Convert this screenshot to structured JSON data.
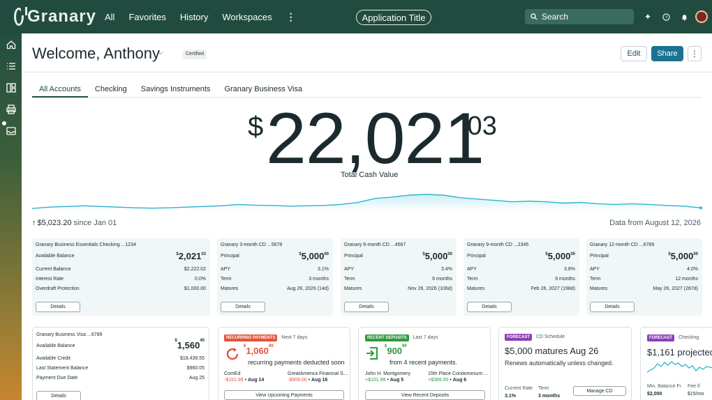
{
  "brand": {
    "name": "Granary"
  },
  "nav": {
    "items": [
      "All",
      "Favorites",
      "History",
      "Workspaces"
    ],
    "more": "⋮"
  },
  "app_title": "Application Title",
  "search": {
    "placeholder": "Search"
  },
  "header": {
    "welcome": "Welcome, Anthony",
    "badge": "Certified",
    "edit": "Edit",
    "share": "Share",
    "more": "⋮"
  },
  "tabs": [
    "All Accounts",
    "Checking",
    "Savings Instruments",
    "Granary Business Visa"
  ],
  "summary": {
    "currency": "$",
    "integer": "22,021",
    "decimal": ".03",
    "label": "Total Cash Value",
    "since_amount": "$5,023.20",
    "since_text": "since Jan 01",
    "data_from": "Data from August 12, 2026"
  },
  "sparkline": [
    0.92,
    0.88,
    0.86,
    0.84,
    0.86,
    0.88,
    0.9,
    0.91,
    0.9,
    0.88,
    0.86,
    0.84,
    0.8,
    0.82,
    0.83,
    0.85,
    0.84,
    0.83,
    0.8,
    0.74,
    0.62,
    0.58,
    0.52,
    0.5,
    0.52,
    0.6,
    0.64,
    0.68,
    0.72,
    0.7,
    0.72,
    0.76,
    0.74,
    0.78,
    0.8,
    0.78,
    0.8,
    0.83,
    0.85,
    0.9
  ],
  "accounts": [
    {
      "title": "Granary Business Essentials Checking ...1234",
      "main_label": "Available Balance",
      "amount": "2,021",
      "cents": "03",
      "rows": [
        [
          "Current Balance",
          "$2,222.02"
        ],
        [
          "Interest Rate",
          "0.0%"
        ],
        [
          "Overdraft Protection",
          "$1,000.00"
        ]
      ],
      "button": "Details"
    },
    {
      "title": "Granary 3-month CD ...5678",
      "main_label": "Principal",
      "amount": "5,000",
      "cents": "00",
      "rows": [
        [
          "APY",
          "3.1%"
        ],
        [
          "Term",
          "3 months"
        ],
        [
          "Matures",
          "Aug 26, 2026 (14d)"
        ]
      ],
      "button": "Details"
    },
    {
      "title": "Granary 6-month CD ...4567",
      "main_label": "Principal",
      "amount": "5,000",
      "cents": "00",
      "rows": [
        [
          "APY",
          "3.4%"
        ],
        [
          "Term",
          "6 months"
        ],
        [
          "Matures",
          "Nov 26, 2026 (106d)"
        ]
      ],
      "button": "Details"
    },
    {
      "title": "Granary 9-month CD ...2345",
      "main_label": "Principal",
      "amount": "5,000",
      "cents": "00",
      "rows": [
        [
          "APY",
          "3.8%"
        ],
        [
          "Term",
          "9 months"
        ],
        [
          "Matures",
          "Feb 26, 2027 (198d)"
        ]
      ],
      "button": "Details"
    },
    {
      "title": "Granary 12-month CD ...6789",
      "main_label": "Principal",
      "amount": "5,000",
      "cents": "00",
      "rows": [
        [
          "APY",
          "4.0%"
        ],
        [
          "Term",
          "12 months"
        ],
        [
          "Matures",
          "May 26, 2027 (287d)"
        ]
      ],
      "button": "Details"
    }
  ],
  "visa": {
    "title": "Granary Business Visa ...6789",
    "main_label": "Available Balance",
    "amount": "1,560",
    "cents": "45",
    "rows": [
      [
        "Available Credit",
        "$18,439.55"
      ],
      [
        "Last Statement Balance",
        "$960.05"
      ],
      [
        "Payment Due Date",
        "Aug 25"
      ]
    ],
    "button": "Details"
  },
  "recurring": {
    "pill": "RECURRING PAYMENTS",
    "period": "Next 7 days",
    "amount": "1,060",
    "cents": "99",
    "desc": "recurring payments deducted soon",
    "items": [
      {
        "name": "ComEd",
        "amount": "-$151.99",
        "date": "Aug 14"
      },
      {
        "name": "GreatAmerica Financial Services",
        "amount": "-$909.00",
        "date": "Aug 16"
      }
    ],
    "button": "View Upcoming Payments",
    "color": "#e5533d"
  },
  "deposits": {
    "pill": "RECENT DEPOSITS",
    "period": "Last 7 days",
    "amount": "900",
    "cents": "99",
    "desc": "from 4 recent payments.",
    "items": [
      {
        "name": "John H. Montgomery",
        "amount": "+$101.99",
        "date": "Aug 5"
      },
      {
        "name": "15th Place Condominium Assoc.",
        "amount": "+$389.00",
        "date": "Aug 6"
      }
    ],
    "button": "View Recent Deposits",
    "color": "#2e9a3e"
  },
  "forecast_cd": {
    "pill": "FORECAST",
    "category": "CD Schedule",
    "headline": "$5,000 matures Aug 26",
    "sub": "Renews automatically unless changed.",
    "stats": [
      [
        "Current Rate",
        "3.1%"
      ],
      [
        "Term",
        "3 months"
      ]
    ],
    "button": "Manage CD"
  },
  "forecast_checking": {
    "pill": "FORECAST",
    "category": "Checking",
    "headline": "$1,161 projected",
    "stats": [
      [
        "Min. Balance Fee",
        "$2,000"
      ],
      [
        "Fee if",
        "$15/mo"
      ]
    ]
  }
}
